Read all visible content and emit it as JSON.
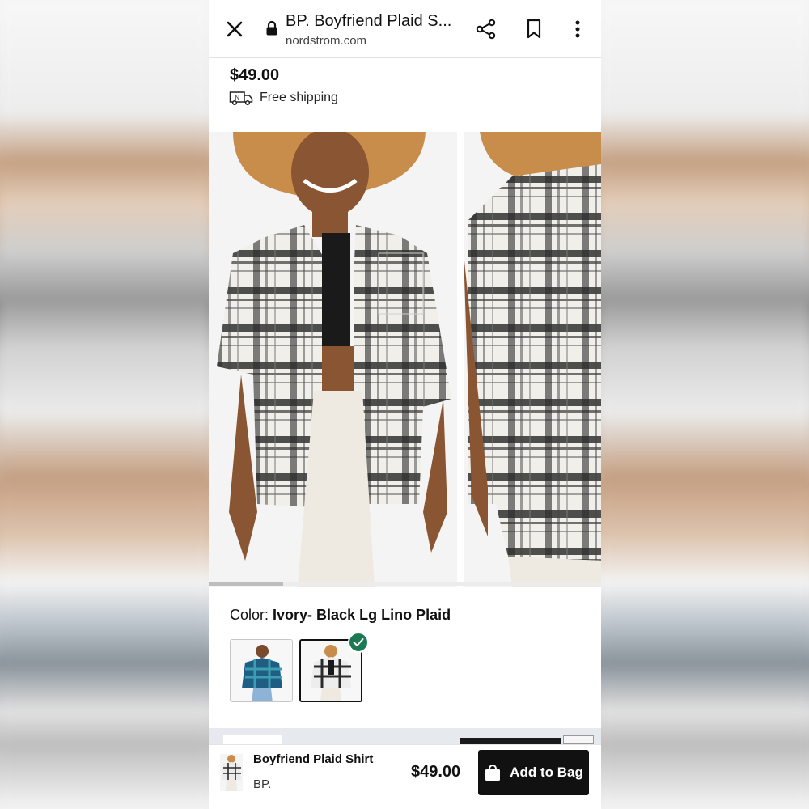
{
  "browser": {
    "title": "BP. Boyfriend Plaid S...",
    "url": "nordstrom.com",
    "icons": [
      "close-icon",
      "lock-icon",
      "share-icon",
      "bookmark-icon",
      "more-vertical-icon"
    ]
  },
  "product": {
    "price": "$49.00",
    "shipping": "Free shipping",
    "shipping_badge": "N"
  },
  "gallery": {
    "image_count_visible": 2,
    "scroll_progress": 0.19
  },
  "color": {
    "label": "Color:",
    "selected": "Ivory- Black Lg Lino Plaid",
    "swatches": [
      {
        "colors": [
          "#1f5e84",
          "#3c9fb0"
        ],
        "selected": false
      },
      {
        "colors": [
          "#ededed",
          "#2a2a2a"
        ],
        "selected": true
      }
    ],
    "check_color": "#1b7a54"
  },
  "bottom_bar": {
    "name": "Boyfriend Plaid Shirt",
    "brand": "BP.",
    "price": "$49.00",
    "add_label": "Add to Bag",
    "add_icon": "shopping-bag-icon"
  }
}
